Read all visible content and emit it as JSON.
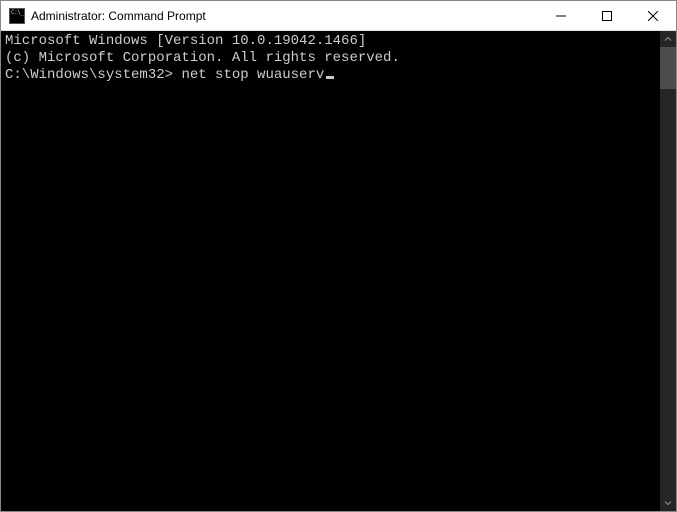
{
  "window": {
    "title": "Administrator: Command Prompt"
  },
  "terminal": {
    "line1": "Microsoft Windows [Version 10.0.19042.1466]",
    "line2": "(c) Microsoft Corporation. All rights reserved.",
    "blank": "",
    "prompt": "C:\\Windows\\system32>",
    "command": "net stop wuauserv"
  }
}
